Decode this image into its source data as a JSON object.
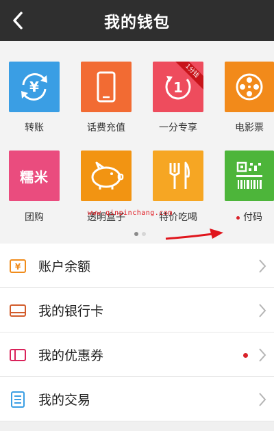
{
  "header": {
    "title": "我的钱包",
    "back_icon": "chevron-left-icon"
  },
  "grid": {
    "row1": [
      {
        "label": "转账",
        "color": "#3a9ee4",
        "icon": "transfer-yuan-icon"
      },
      {
        "label": "话费充值",
        "color": "#f26b33",
        "icon": "phone-icon"
      },
      {
        "label": "一分专享",
        "color": "#ee4c5d",
        "icon": "one-cent-icon",
        "ribbon": "1分钱"
      },
      {
        "label": "电影票",
        "color": "#f28a1a",
        "icon": "film-reel-icon"
      }
    ],
    "row2": [
      {
        "label": "团购",
        "color": "#ea4c7e",
        "icon": "groupbuy-icon",
        "text": "糯米"
      },
      {
        "label": "透明盒子",
        "color": "#f29412",
        "icon": "piggy-bank-icon"
      },
      {
        "label": "特价吃喝",
        "color": "#f6a623",
        "icon": "fork-knife-icon"
      },
      {
        "label": "付码",
        "color": "#4db53a",
        "icon": "pay-code-icon",
        "dot": true
      }
    ]
  },
  "pager": {
    "pages": 2,
    "active": 0
  },
  "watermark": "www.qinpinchang.com",
  "list": [
    {
      "label": "账户余额",
      "icon": "balance-icon",
      "color": "#f08c1b",
      "dot": false
    },
    {
      "label": "我的银行卡",
      "icon": "bank-card-icon",
      "color": "#d25b2a",
      "dot": false
    },
    {
      "label": "我的优惠券",
      "icon": "coupon-icon",
      "color": "#d9225a",
      "dot": true
    },
    {
      "label": "我的交易",
      "icon": "transactions-icon",
      "color": "#3a9ee4",
      "dot": false
    }
  ]
}
